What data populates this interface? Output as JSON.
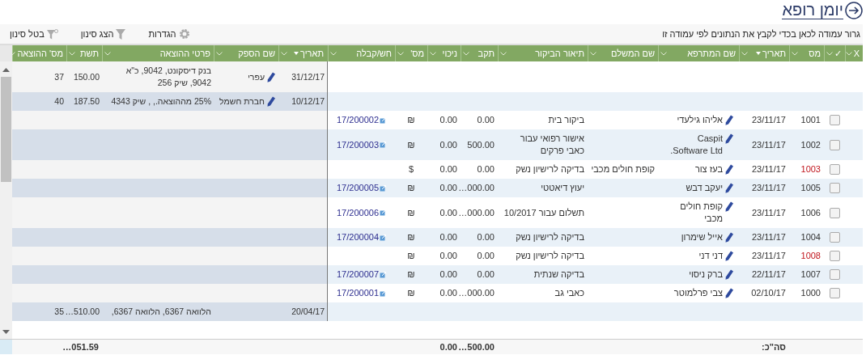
{
  "page_title": "יומן רופא",
  "toolbar": {
    "group_hint": "גרור עמודה לכאן בכדי לקבץ את הנתונים לפי עמודה זו",
    "buttons": [
      {
        "label": "הגדרות",
        "kind": "settings"
      },
      {
        "label": "הצג סינון",
        "kind": "filter"
      },
      {
        "label": "בטל סינון",
        "kind": "clear_filter"
      }
    ]
  },
  "visit_columns": [
    {
      "label": "X",
      "sorted": false
    },
    {
      "label": "✓",
      "sorted": false
    },
    {
      "label": "מס",
      "sorted": false
    },
    {
      "label": "תאריך",
      "sorted": true
    },
    {
      "label": "שם המתרפא",
      "sorted": false
    },
    {
      "label": "שם המשלם",
      "sorted": false
    },
    {
      "label": "תיאור הביקור",
      "sorted": false
    },
    {
      "label": "תקב",
      "sorted": false
    },
    {
      "label": "ניכוי",
      "sorted": false
    },
    {
      "label": "מס'",
      "sorted": false
    },
    {
      "label": "חש/קבלה",
      "sorted": false
    }
  ],
  "expense_columns": [
    {
      "label": "תאריך",
      "sorted": true
    },
    {
      "label": "שם הספק",
      "sorted": false
    },
    {
      "label": "פרטי ההוצאה",
      "sorted": false
    },
    {
      "label": "תשת",
      "sorted": false
    },
    {
      "label": "מס' ההוצאה",
      "sorted": false
    }
  ],
  "rows": [
    {
      "expense": {
        "date": "31/12/17",
        "supplier": "עפרי",
        "details": "בנק דיסקונט, 9042, כ\"א 9042, שיק 256",
        "amount": "150.00",
        "number": "37"
      }
    },
    {
      "expense": {
        "date": "10/12/17",
        "supplier": "חברת חשמל",
        "details": "25% מההוצאה., , שיק 4343",
        "amount": "187.50",
        "number": "40"
      }
    },
    {
      "visit": {
        "selected": false,
        "number": "1001",
        "flagged": false,
        "date": "23/11/17",
        "patient": "אליהו גילעדי",
        "description": "ביקור בית",
        "tkb": "0.00",
        "deduction": "0.00",
        "currency": "₪",
        "receipt": "17/200002"
      }
    },
    {
      "visit": {
        "selected": false,
        "number": "1002",
        "flagged": false,
        "date": "23/11/17",
        "patient": "Caspit Software Ltd.",
        "description": "אישור רפואי עבור כאבי פרקים",
        "tkb": "500.00",
        "deduction": "0.00",
        "currency": "₪",
        "receipt": "17/200003"
      }
    },
    {
      "visit": {
        "selected": false,
        "number": "1003",
        "flagged": true,
        "date": "23/11/17",
        "patient": "בעז צור",
        "payer": "קופת חולים מכבי",
        "description": "בדיקה לרישיון נשק",
        "tkb": "0.00",
        "deduction": "0.00",
        "currency": "$"
      }
    },
    {
      "visit": {
        "selected": false,
        "number": "1005",
        "flagged": false,
        "date": "23/11/17",
        "patient": "יעקב דבש",
        "description": "יעוץ דיאטטי",
        "tkb": "…000.00",
        "deduction": "0.00",
        "currency": "₪",
        "receipt": "17/200005"
      }
    },
    {
      "visit": {
        "selected": false,
        "number": "1006",
        "flagged": false,
        "date": "23/11/17",
        "patient": "קופת חולים מכבי",
        "description": "תשלום עבור 10/2017",
        "tkb": "…000.00",
        "deduction": "0.00",
        "currency": "₪",
        "receipt": "17/200006"
      }
    },
    {
      "visit": {
        "selected": false,
        "number": "1004",
        "flagged": false,
        "date": "23/11/17",
        "patient": "אייל שימרון",
        "description": "בדיקה לרישיון נשק",
        "tkb": "0.00",
        "deduction": "0.00",
        "currency": "₪",
        "receipt": "17/200004"
      }
    },
    {
      "visit": {
        "selected": false,
        "number": "1008",
        "flagged": true,
        "date": "23/11/17",
        "patient": "דני דני",
        "description": "בדיקה לרישיון נשק",
        "tkb": "0.00",
        "deduction": "0.00",
        "currency": "₪"
      }
    },
    {
      "visit": {
        "selected": false,
        "number": "1007",
        "flagged": false,
        "date": "22/11/17",
        "patient": "ברק ניסוי",
        "description": "בדיקה שנתית",
        "tkb": "0.00",
        "deduction": "0.00",
        "currency": "₪",
        "receipt": "17/200007"
      }
    },
    {
      "visit": {
        "selected": false,
        "number": "1000",
        "flagged": false,
        "date": "02/10/17",
        "patient": "צבי פרלמוטר",
        "description": "כאבי גב",
        "tkb": "…000.00",
        "deduction": "0.00",
        "currency": "₪",
        "receipt": "17/200001"
      }
    },
    {
      "expense": {
        "date": "20/04/17",
        "details": "הלוואה 6367, הלוואה 6367,",
        "amount": "…510.00",
        "number": "35"
      }
    }
  ],
  "totals": {
    "label": "סה\"כ:",
    "tkb": "…500.00",
    "deduction": "0.00",
    "expense_amount": "…051.59"
  }
}
